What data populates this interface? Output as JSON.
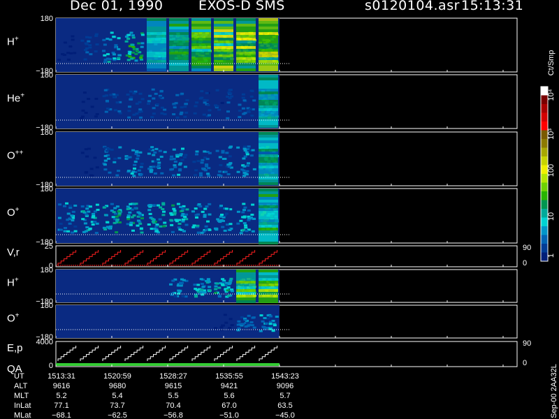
{
  "header": {
    "date": "Dec 01, 1990",
    "mission": "EXOS-D SMS",
    "file": "s0120104.asr",
    "time": "15:13:31"
  },
  "colorbar": {
    "unit_label": "Ct/Smp",
    "tick_labels": [
      "10⁴",
      "10³",
      "100",
      "10",
      "1"
    ],
    "colors": [
      "#ffffff",
      "#7a0000",
      "#a80000",
      "#d40000",
      "#ff0000",
      "#7a5a00",
      "#8c7a00",
      "#a8a800",
      "#c8d400",
      "#f0f000",
      "#b4e600",
      "#6ed200",
      "#28b400",
      "#009650",
      "#00aa9a",
      "#00d2d2",
      "#0096c8",
      "#0064b4",
      "#003c96",
      "#001e78"
    ]
  },
  "chart_data": {
    "type": "heatmap",
    "x_axis": {
      "label": "UT",
      "ticks": [
        "1513:31",
        "1520:59",
        "1528:27",
        "1535:55",
        "1543:23"
      ]
    },
    "panels": [
      {
        "name": "H+",
        "label": "H",
        "sup": "+",
        "type": "heatmap",
        "ylim": [
          -180,
          180
        ],
        "ytop": "180",
        "ybot": "−180",
        "data_end": "1543:23",
        "activity": [
          0.05,
          0.15,
          0.35,
          0.5,
          0.55,
          0.6,
          0.7,
          0.85,
          0.9,
          0.95
        ]
      },
      {
        "name": "He+",
        "label": "He",
        "sup": "+",
        "type": "heatmap",
        "ylim": [
          -180,
          180
        ],
        "ytop": "180",
        "ybot": "−180",
        "activity": [
          0.0,
          0.05,
          0.2,
          0.2,
          0.2,
          0.2,
          0.15,
          0.15,
          0.2,
          0.55
        ]
      },
      {
        "name": "O++",
        "label": "O",
        "sup": "++",
        "type": "heatmap",
        "ylim": [
          -180,
          180
        ],
        "ytop": "180",
        "ybot": "−180",
        "activity": [
          0.0,
          0.05,
          0.25,
          0.3,
          0.3,
          0.3,
          0.25,
          0.25,
          0.3,
          0.55
        ]
      },
      {
        "name": "O+",
        "label": "O",
        "sup": "+",
        "type": "heatmap",
        "ylim": [
          -180,
          180
        ],
        "ytop": "180",
        "ybot": "−180",
        "activity": [
          0.3,
          0.4,
          0.45,
          0.45,
          0.45,
          0.45,
          0.35,
          0.3,
          0.35,
          0.6
        ]
      },
      {
        "name": "V,r",
        "label": "V,r",
        "type": "line",
        "ylim": [
          0,
          25
        ],
        "ytop": "25",
        "ybot": "0",
        "right_top": "90",
        "right_bot": "0",
        "series_color": "#ff2020"
      },
      {
        "name": "H+ (2)",
        "label": "H",
        "sup": "+",
        "type": "heatmap",
        "ylim": [
          -180,
          180
        ],
        "ytop": "180",
        "ybot": "−180",
        "activity": [
          0.0,
          0.0,
          0.0,
          0.0,
          0.0,
          0.3,
          0.4,
          0.45,
          0.75,
          0.8
        ]
      },
      {
        "name": "O+ (2)",
        "label": "O",
        "sup": "+",
        "type": "heatmap",
        "ylim": [
          -180,
          180
        ],
        "ytop": "180",
        "ybot": "−180",
        "activity": [
          0.0,
          0.0,
          0.0,
          0.0,
          0.0,
          0.0,
          0.0,
          0.05,
          0.25,
          0.3
        ]
      },
      {
        "name": "E,p",
        "label": "E,p",
        "label2": "QA",
        "type": "line",
        "ylim": [
          0,
          4000
        ],
        "ytop": "4000",
        "ybot": "0",
        "right_top": "90",
        "right_bot": "0",
        "series_color": "#ffffff",
        "qa_color": "#33cc33"
      }
    ],
    "ephemeris": {
      "rows": [
        {
          "label": "UT",
          "values": [
            "1513:31",
            "1520:59",
            "1528:27",
            "1535:55",
            "1543:23"
          ]
        },
        {
          "label": "ALT",
          "values": [
            "9616",
            "9680",
            "9615",
            "9421",
            "9096"
          ]
        },
        {
          "label": "MLT",
          "values": [
            "5.2",
            "5.4",
            "5.5",
            "5.6",
            "5.7"
          ]
        },
        {
          "label": "InLat",
          "values": [
            "77.1",
            "73.7",
            "70.4",
            "67.0",
            "63.5"
          ]
        },
        {
          "label": "MLat",
          "values": [
            "−68.1",
            "−62.5",
            "−56.8",
            "−51.0",
            "−45.0"
          ]
        }
      ]
    },
    "footer_id": "Sep-00  2AA32L"
  }
}
